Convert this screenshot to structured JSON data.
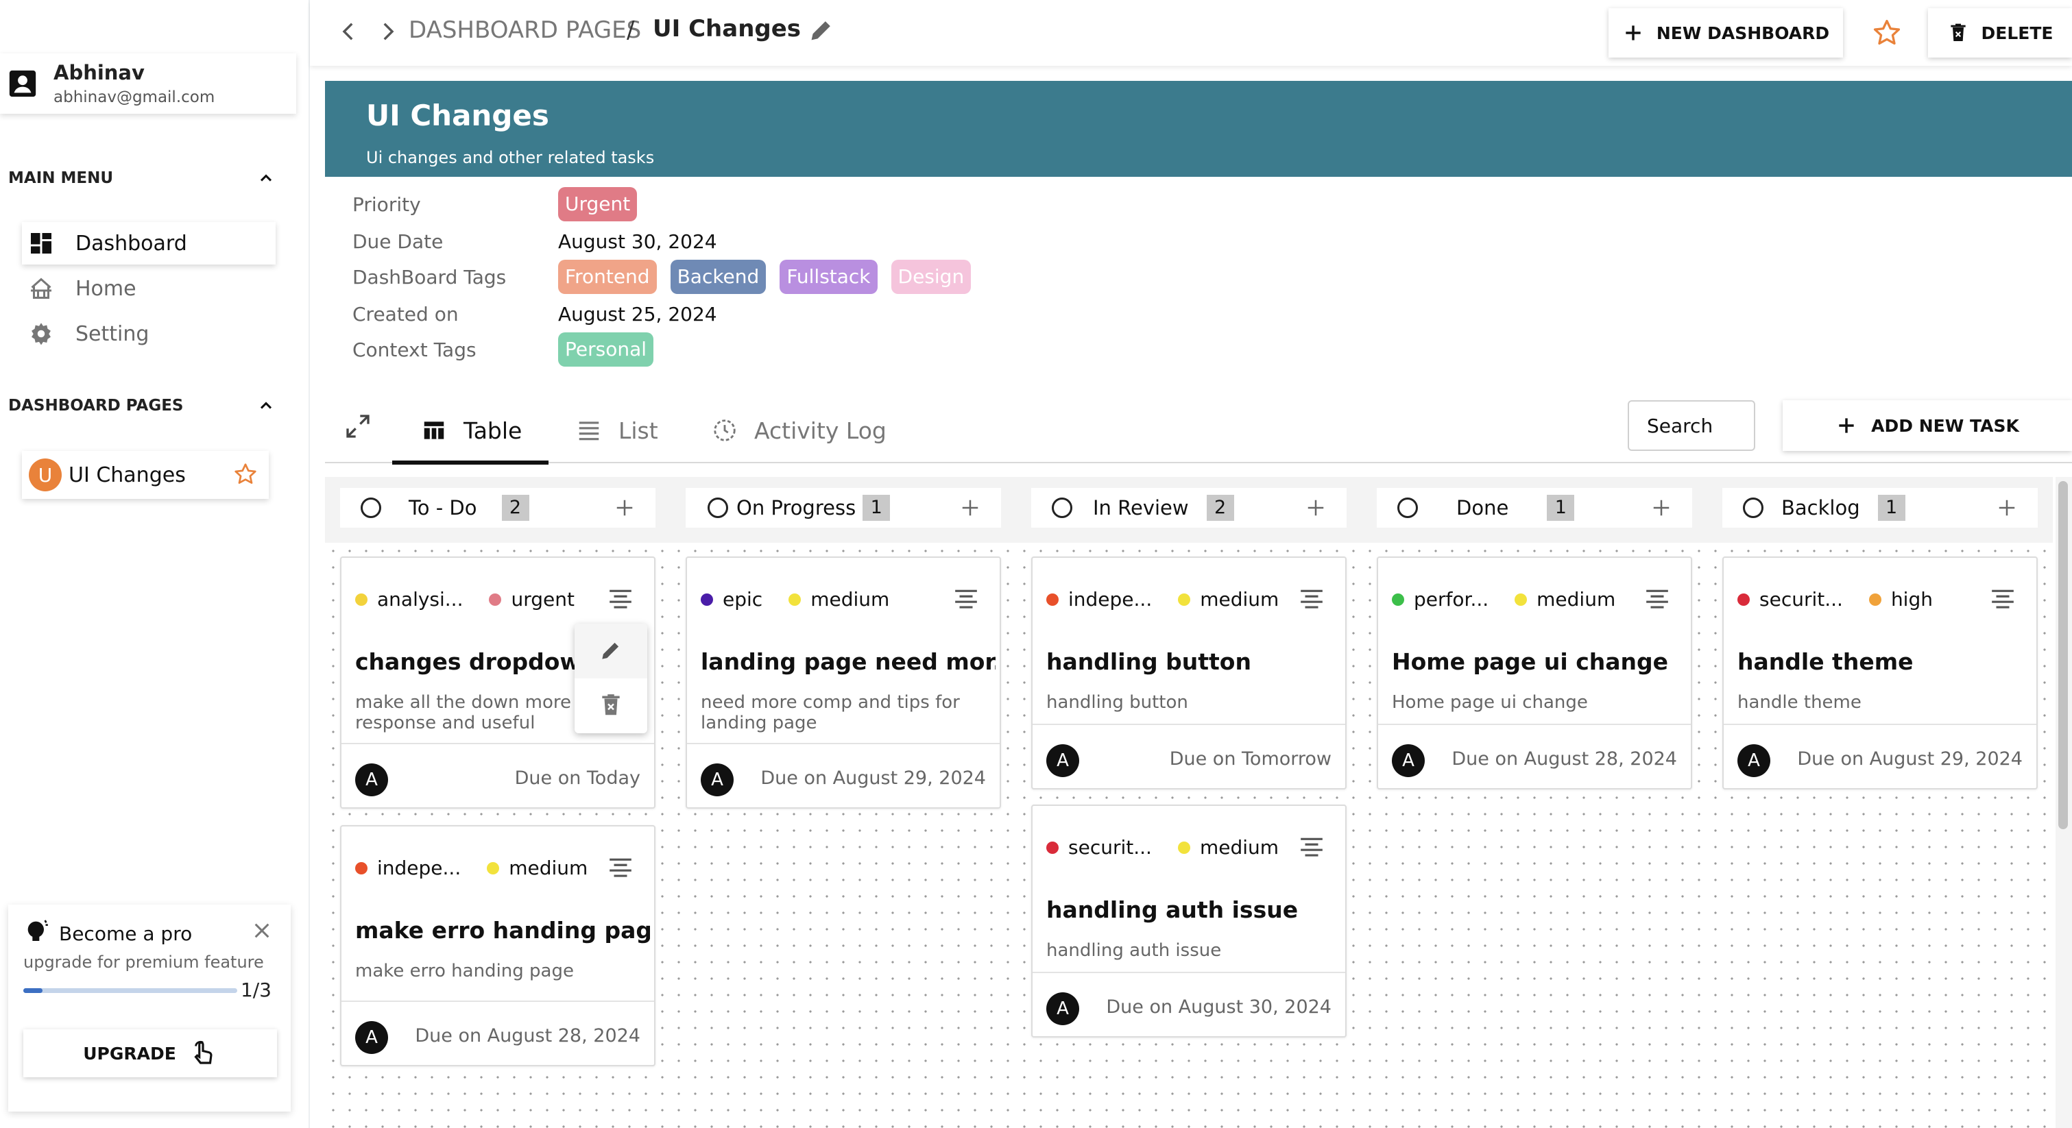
{
  "sidebar": {
    "user": {
      "name": "Abhinav",
      "email": "abhinav@gmail.com"
    },
    "main_menu": {
      "title": "MAIN MENU",
      "items": [
        {
          "label": "Dashboard",
          "icon": "dashboard-icon",
          "active": true
        },
        {
          "label": "Home",
          "icon": "home-icon",
          "active": false
        },
        {
          "label": "Setting",
          "icon": "gear-icon",
          "active": false
        }
      ]
    },
    "dashboard_pages": {
      "title": "DASHBOARD PAGES",
      "items": [
        {
          "avatar": "U",
          "label": "UI Changes",
          "starred": true
        }
      ]
    },
    "pro": {
      "title": "Become a pro",
      "subtitle": "upgrade for premium feature",
      "progress": "1/3",
      "progress_fraction": 0.09,
      "button": "UPGRADE"
    }
  },
  "topbar": {
    "breadcrumb_root": "DASHBOARD PAGES",
    "breadcrumb_sep": "/",
    "breadcrumb_current": "UI Changes",
    "new_dashboard": "NEW DASHBOARD",
    "delete": "DELETE"
  },
  "header": {
    "title": "UI Changes",
    "subtitle": "Ui changes and other related tasks"
  },
  "details": {
    "priority_label": "Priority",
    "priority": "Urgent",
    "due_label": "Due Date",
    "due": "August 30, 2024",
    "tags_label": "DashBoard Tags",
    "tags": [
      "Frontend",
      "Backend",
      "Fullstack",
      "Design"
    ],
    "created_label": "Created on",
    "created": "August 25, 2024",
    "context_label": "Context Tags",
    "context_tags": [
      "Personal"
    ]
  },
  "colors": {
    "banner": "#3c7b8d",
    "urgent": "#e07b86",
    "frontend": "#f0a488",
    "backend": "#6f8ab5",
    "fullstack": "#b98fe0",
    "design": "#f5c4dc",
    "personal": "#7fd1ad"
  },
  "tabs": [
    {
      "label": "Table",
      "icon": "table-icon",
      "active": true
    },
    {
      "label": "List",
      "icon": "list-icon",
      "active": false
    },
    {
      "label": "Activity Log",
      "icon": "clock-icon",
      "active": false
    }
  ],
  "toolbar": {
    "search": "Search",
    "add_task": "ADD NEW TASK"
  },
  "columns": [
    {
      "name": "To - Do",
      "count": "2"
    },
    {
      "name": "On Progress",
      "count": "1"
    },
    {
      "name": "In Review",
      "count": "2"
    },
    {
      "name": "Done",
      "count": "1"
    },
    {
      "name": "Backlog",
      "count": "1"
    }
  ],
  "cards": {
    "todo_1": {
      "tag1": "analysi...",
      "tag1_color": "#f2d23c",
      "tag2": "urgent",
      "tag2_color": "#e07b86",
      "title": "changes dropdown",
      "desc": "make all the down more response and useful",
      "avatar": "A",
      "due": "Due on Today"
    },
    "todo_2": {
      "tag1": "indepe...",
      "tag1_color": "#e8502a",
      "tag2": "medium",
      "tag2_color": "#f2e23c",
      "title": "make erro handing page",
      "desc": "make erro handing page",
      "avatar": "A",
      "due": "Due on August 28, 2024"
    },
    "progress_1": {
      "tag1": "epic",
      "tag1_color": "#4a1da8",
      "tag2": "medium",
      "tag2_color": "#f2e23c",
      "title": "landing page need mor...",
      "desc": "need more comp and tips for landing page",
      "avatar": "A",
      "due": "Due on August 29, 2024"
    },
    "review_1": {
      "tag1": "indepe...",
      "tag1_color": "#e8502a",
      "tag2": "medium",
      "tag2_color": "#f2e23c",
      "title": "handling button",
      "desc": "handling button",
      "avatar": "A",
      "due": "Due on Tomorrow"
    },
    "review_2": {
      "tag1": "securit...",
      "tag1_color": "#d92b3a",
      "tag2": "medium",
      "tag2_color": "#f2e23c",
      "title": "handling auth issue",
      "desc": "handling auth issue",
      "avatar": "A",
      "due": "Due on August 30, 2024"
    },
    "done_1": {
      "tag1": "perfor...",
      "tag1_color": "#3cbf4a",
      "tag2": "medium",
      "tag2_color": "#f2e23c",
      "title": "Home page ui change",
      "desc": "Home page ui change",
      "avatar": "A",
      "due": "Due on August 28, 2024"
    },
    "backlog_1": {
      "tag1": "securit...",
      "tag1_color": "#d92b3a",
      "tag2": "high",
      "tag2_color": "#f0a23a",
      "title": "handle theme",
      "desc": "handle theme",
      "avatar": "A",
      "due": "Due on August 29, 2024"
    }
  }
}
